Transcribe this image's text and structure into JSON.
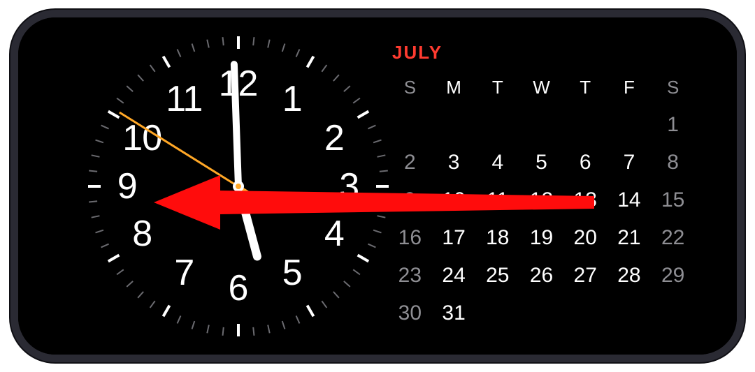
{
  "clock": {
    "numbers": [
      "12",
      "1",
      "2",
      "3",
      "4",
      "5",
      "6",
      "7",
      "8",
      "9",
      "10",
      "11"
    ],
    "hour_angle": 165,
    "minute_angle": -2,
    "second_angle": -58
  },
  "calendar": {
    "month_label": "JULY",
    "day_headers": [
      "S",
      "M",
      "T",
      "W",
      "T",
      "F",
      "S"
    ],
    "weeks": [
      [
        {
          "n": "",
          "o": true
        },
        {
          "n": "",
          "o": true
        },
        {
          "n": "",
          "o": true
        },
        {
          "n": "",
          "o": true
        },
        {
          "n": "",
          "o": true
        },
        {
          "n": "",
          "o": true
        },
        {
          "n": "1",
          "o": false
        }
      ],
      [
        {
          "n": "2",
          "o": false
        },
        {
          "n": "3",
          "o": false
        },
        {
          "n": "4",
          "o": false
        },
        {
          "n": "5",
          "o": false
        },
        {
          "n": "6",
          "o": false
        },
        {
          "n": "7",
          "o": false
        },
        {
          "n": "8",
          "o": false
        }
      ],
      [
        {
          "n": "9",
          "o": false
        },
        {
          "n": "10",
          "o": false
        },
        {
          "n": "11",
          "o": false
        },
        {
          "n": "12",
          "o": false
        },
        {
          "n": "13",
          "o": false
        },
        {
          "n": "14",
          "o": false
        },
        {
          "n": "15",
          "o": false
        }
      ],
      [
        {
          "n": "16",
          "o": false
        },
        {
          "n": "17",
          "o": false
        },
        {
          "n": "18",
          "o": false
        },
        {
          "n": "19",
          "o": false
        },
        {
          "n": "20",
          "o": false
        },
        {
          "n": "21",
          "o": false
        },
        {
          "n": "22",
          "o": false
        }
      ],
      [
        {
          "n": "23",
          "o": false
        },
        {
          "n": "24",
          "o": false
        },
        {
          "n": "25",
          "o": false
        },
        {
          "n": "26",
          "o": false
        },
        {
          "n": "27",
          "o": false
        },
        {
          "n": "28",
          "o": false
        },
        {
          "n": "29",
          "o": false
        }
      ],
      [
        {
          "n": "30",
          "o": false
        },
        {
          "n": "31",
          "o": false,
          "today": true
        },
        {
          "n": "",
          "o": true
        },
        {
          "n": "",
          "o": true
        },
        {
          "n": "",
          "o": true
        },
        {
          "n": "",
          "o": true
        },
        {
          "n": "",
          "o": true
        }
      ]
    ]
  },
  "annotation": {
    "arrow_color": "#ff0c0c"
  }
}
